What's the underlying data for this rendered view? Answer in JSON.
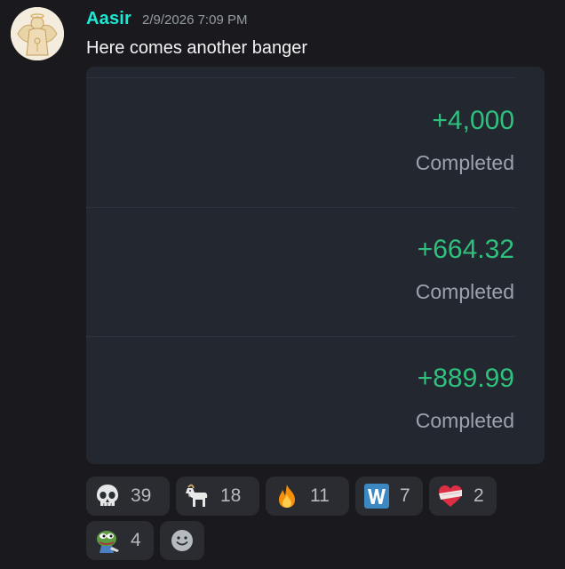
{
  "message": {
    "author": "Aasir",
    "timestamp": "2/9/2026 7:09 PM",
    "text": "Here comes another banger",
    "avatar_icon": "angel-statue-avatar",
    "author_color": "#1ee7d3"
  },
  "embed": {
    "transactions": [
      {
        "amount": "+4,000",
        "status": "Completed"
      },
      {
        "amount": "+664.32",
        "status": "Completed"
      },
      {
        "amount": "+889.99",
        "status": "Completed"
      }
    ],
    "amount_color": "#2fc07d"
  },
  "reactions": [
    {
      "emoji": "skull-emoji",
      "count": "39"
    },
    {
      "emoji": "goat-emoji",
      "count": "18"
    },
    {
      "emoji": "fire-emoji",
      "count": "11"
    },
    {
      "emoji": "w-letter-emoji",
      "count": "7"
    },
    {
      "emoji": "bandaged-heart-emoji",
      "count": "2"
    },
    {
      "emoji": "pepe-emoji",
      "count": "4"
    }
  ],
  "add_reaction_icon": "smiley-add-reaction-icon"
}
